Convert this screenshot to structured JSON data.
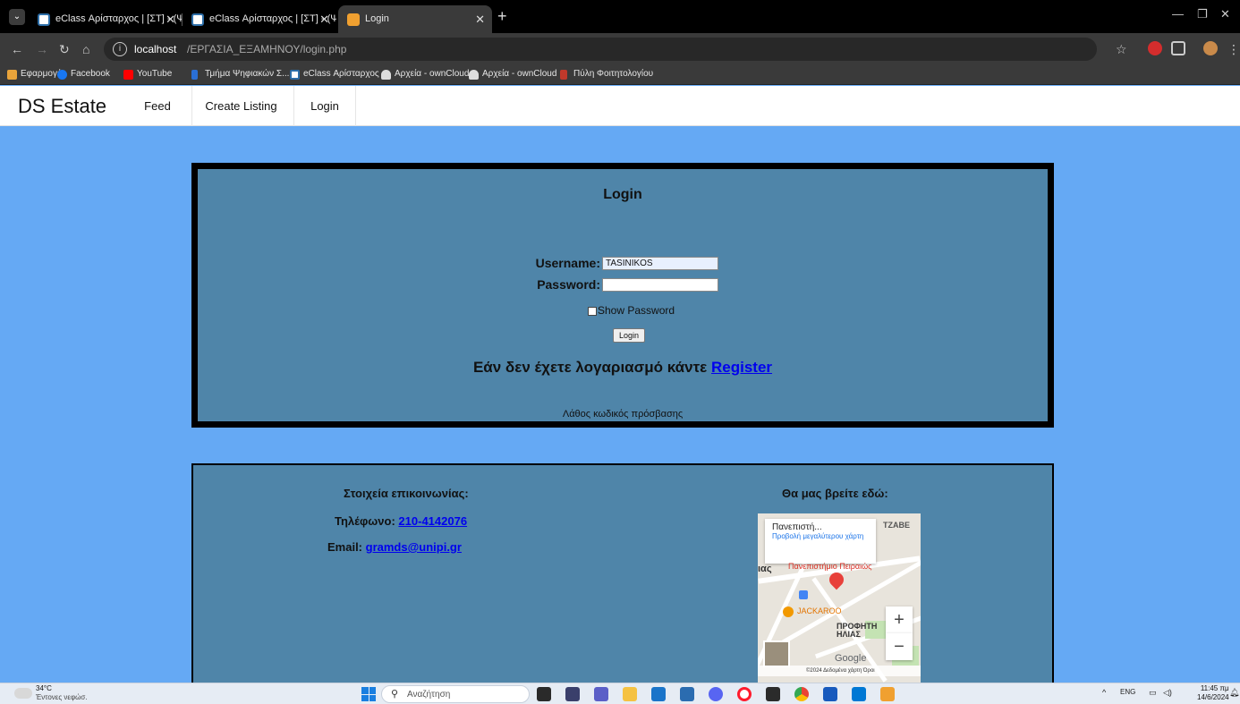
{
  "browser": {
    "tabs": [
      {
        "title": "eClass Αρίσταρχος | [ΣΤ] - (Ψ",
        "active": false
      },
      {
        "title": "eClass Αρίσταρχος | [ΣΤ] - (Ψ",
        "active": false
      },
      {
        "title": "Login",
        "active": true
      }
    ],
    "url_host": "localhost",
    "url_path": "/ΕΡΓΑΣΙΑ_ΕΞΑΜΗΝΟΥ/login.php",
    "bookmarks": [
      {
        "label": "Εφαρμογές",
        "icon": "apps-grid-icon"
      },
      {
        "label": "Facebook",
        "icon": "facebook-icon"
      },
      {
        "label": "YouTube",
        "icon": "youtube-icon"
      },
      {
        "label": "Τμήμα Ψηφιακών Σ...",
        "icon": "department-icon"
      },
      {
        "label": "eClass Αρίσταρχος",
        "icon": "eclass-icon"
      },
      {
        "label": "Αρχεία - ownCloud",
        "icon": "owncloud-icon"
      },
      {
        "label": "Αρχεία - ownCloud",
        "icon": "owncloud-icon"
      },
      {
        "label": "Πύλη Φοιτητολογίου",
        "icon": "portal-icon"
      }
    ]
  },
  "site": {
    "brand": "DS Estate",
    "nav": [
      "Feed",
      "Create Listing",
      "Login"
    ]
  },
  "login": {
    "title": "Login",
    "username_label": "Username:",
    "username_value": "TASINIKOS",
    "password_label": "Password:",
    "password_value": "",
    "show_password_label": "Show Password",
    "show_password_checked": false,
    "submit_label": "Login",
    "register_prompt": "Εάν δεν έχετε λογαριασμό κάντε",
    "register_link": "Register",
    "error_message": "Λάθος κωδικός πρόσβασης"
  },
  "contact": {
    "heading": "Στοιχεία επικοινωνίας:",
    "phone_label": "Τηλέφωνο:",
    "phone": "210-4142076",
    "email_label": "Email:",
    "email": "gramds@unipi.gr",
    "map_heading": "Θα μας βρείτε εδώ:"
  },
  "map": {
    "place_title": "Πανεπιστή...",
    "view_larger": "Προβολή μεγαλύτερου χάρτη",
    "university_label": "Πανεπιστήμιο Πειραιώς",
    "area_label_1": "ΤΖΑΒΕ",
    "area_label_2": "ΠΡΟΦΗΤΗ ΗΛΙΑΣ",
    "poi_label": "JACKAROO",
    "partial_label": "ιας",
    "google": "Google",
    "copyright": "©2024 Δεδομένα χάρτη  Όροι",
    "zoom_in": "+",
    "zoom_out": "−"
  },
  "taskbar": {
    "temperature": "34°C",
    "weather": "Έντονες νεφώσ.",
    "search_placeholder": "Αναζήτηση",
    "lang": "ENG",
    "time": "11:45 πμ",
    "date": "14/6/2024"
  },
  "colors": {
    "page_bg": "#65a9f4",
    "panel_bg": "#4f85a9",
    "link": "#0000ee"
  }
}
